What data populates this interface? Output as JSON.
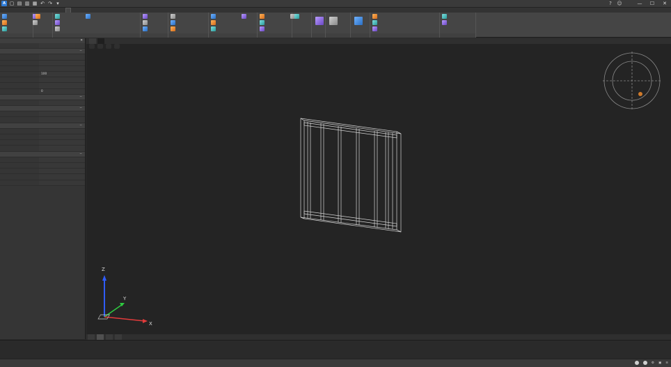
{
  "window": {
    "title": "",
    "logo": "A",
    "controls": [
      "—",
      "☐",
      "✕"
    ]
  },
  "quick_access": [
    "▢",
    "▤",
    "▥",
    "▦",
    "↶",
    "↷",
    "▾"
  ],
  "ribbon_tabs": [
    {
      "label": ""
    },
    {
      "label": ""
    },
    {
      "label": ""
    },
    {
      "label": ""
    },
    {
      "label": ""
    },
    {
      "label": ""
    },
    {
      "label": ""
    },
    {
      "label": ""
    },
    {
      "label": ""
    },
    {
      "label": ""
    },
    {
      "label": ""
    },
    {
      "label": ""
    },
    {
      "label": ""
    }
  ],
  "ribbon_groups": [
    {
      "label": "",
      "buttons": [
        "",
        "",
        "",
        "",
        ""
      ]
    },
    {
      "label": "",
      "buttons": [
        ""
      ]
    },
    {
      "label": "",
      "buttons": [
        "",
        "",
        "",
        ""
      ]
    },
    {
      "label": "",
      "buttons": [
        "",
        "",
        ""
      ]
    },
    {
      "label": "",
      "buttons": [
        "",
        "",
        ""
      ]
    },
    {
      "label": "",
      "buttons": [
        "",
        "",
        "",
        ""
      ]
    },
    {
      "label": "",
      "buttons": [
        "",
        "",
        "",
        ""
      ]
    },
    {
      "label": "",
      "buttons": [
        ""
      ]
    },
    {
      "label": "",
      "buttons": []
    },
    {
      "label": "",
      "buttons": []
    },
    {
      "label": "",
      "buttons": []
    },
    {
      "label": "",
      "buttons": [
        "",
        "",
        ""
      ]
    },
    {
      "label": "",
      "buttons": [
        "",
        ""
      ]
    }
  ],
  "document_tabs": [
    {
      "label": ""
    },
    {
      "label": ""
    }
  ],
  "view_tabs": [
    "",
    "",
    "",
    ""
  ],
  "palette": {
    "title": "",
    "rows": [
      {
        "type": "row",
        "k": "",
        "v": ""
      },
      {
        "type": "section",
        "k": ""
      },
      {
        "type": "row",
        "k": "",
        "v": ""
      },
      {
        "type": "row",
        "k": "",
        "v": ""
      },
      {
        "type": "row",
        "k": "",
        "v": ""
      },
      {
        "type": "row",
        "k": "",
        "v": "100"
      },
      {
        "type": "row",
        "k": "",
        "v": ""
      },
      {
        "type": "row",
        "k": "",
        "v": ""
      },
      {
        "type": "row",
        "k": "",
        "v": "0"
      },
      {
        "type": "section",
        "k": ""
      },
      {
        "type": "row",
        "k": "",
        "v": ""
      },
      {
        "type": "section",
        "k": ""
      },
      {
        "type": "row",
        "k": "",
        "v": ""
      },
      {
        "type": "row",
        "k": "",
        "v": ""
      },
      {
        "type": "section",
        "k": ""
      },
      {
        "type": "row",
        "k": "",
        "v": ""
      },
      {
        "type": "row",
        "k": "",
        "v": ""
      },
      {
        "type": "row",
        "k": "",
        "v": ""
      },
      {
        "type": "row",
        "k": "",
        "v": ""
      },
      {
        "type": "section",
        "k": ""
      },
      {
        "type": "row",
        "k": "",
        "v": ""
      },
      {
        "type": "row",
        "k": "",
        "v": ""
      },
      {
        "type": "row",
        "k": "",
        "v": ""
      },
      {
        "type": "row",
        "k": "",
        "v": ""
      },
      {
        "type": "row",
        "k": "",
        "v": ""
      }
    ]
  },
  "ucs_labels": {
    "x": "X",
    "y": "Y",
    "z": "Z"
  },
  "layout_tabs": [
    "",
    "",
    "",
    ""
  ],
  "command_line": [
    {
      "text": ""
    },
    {
      "text": ""
    },
    {
      "text": ""
    },
    {
      "text": ""
    }
  ],
  "status_modes": [
    {
      "label": "",
      "on": false
    },
    {
      "label": "",
      "on": false
    },
    {
      "label": "",
      "on": true
    },
    {
      "label": "",
      "on": true
    },
    {
      "label": "",
      "on": false
    },
    {
      "label": "",
      "on": false
    },
    {
      "label": "",
      "on": false
    },
    {
      "label": "",
      "on": false
    },
    {
      "label": "",
      "on": true
    },
    {
      "label": "",
      "on": false
    },
    {
      "label": "",
      "on": false
    },
    {
      "label": "",
      "on": true
    }
  ],
  "status_right": {
    "scale": "",
    "zoom": ""
  },
  "colors": {
    "accent": "#2e7bd6",
    "background": "#242424",
    "ribbon": "#454545"
  }
}
